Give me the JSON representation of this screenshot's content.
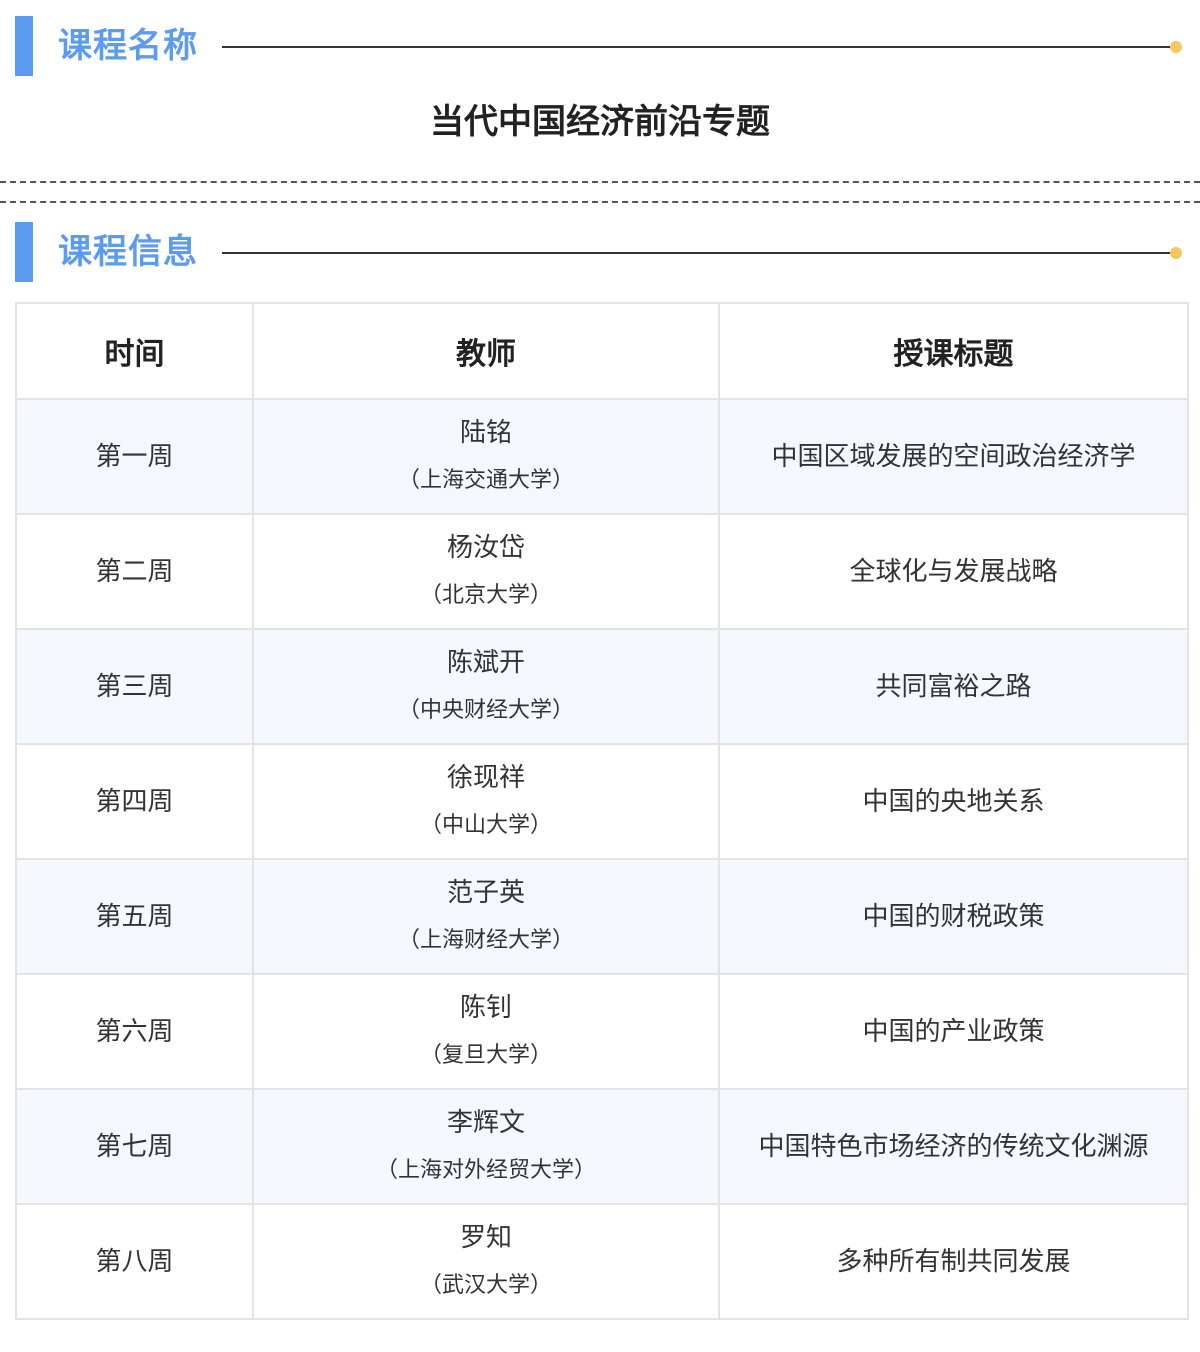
{
  "course_name_section": {
    "heading": "课程名称",
    "course_title": "当代中国经济前沿专题"
  },
  "course_info_section": {
    "heading": "课程信息"
  },
  "table": {
    "headers": {
      "time": "时间",
      "teacher": "教师",
      "topic": "授课标题"
    },
    "rows": [
      {
        "week": "第一周",
        "teacher": "陆铭",
        "school": "（上海交通大学）",
        "topic": "中国区域发展的空间政治经济学"
      },
      {
        "week": "第二周",
        "teacher": "杨汝岱",
        "school": "（北京大学）",
        "topic": "全球化与发展战略"
      },
      {
        "week": "第三周",
        "teacher": "陈斌开",
        "school": "（中央财经大学）",
        "topic": "共同富裕之路"
      },
      {
        "week": "第四周",
        "teacher": "徐现祥",
        "school": "（中山大学）",
        "topic": "中国的央地关系"
      },
      {
        "week": "第五周",
        "teacher": "范子英",
        "school": "（上海财经大学）",
        "topic": "中国的财税政策"
      },
      {
        "week": "第六周",
        "teacher": "陈钊",
        "school": "（复旦大学）",
        "topic": "中国的产业政策"
      },
      {
        "week": "第七周",
        "teacher": "李辉文",
        "school": "（上海对外经贸大学）",
        "topic": "中国特色市场经济的传统文化渊源"
      },
      {
        "week": "第八周",
        "teacher": "罗知",
        "school": "（武汉大学）",
        "topic": "多种所有制共同发展"
      }
    ]
  },
  "colors": {
    "accent_blue": "#5b9bf0",
    "accent_dot": "#f7c65c",
    "row_tint": "#f5f9fe"
  }
}
